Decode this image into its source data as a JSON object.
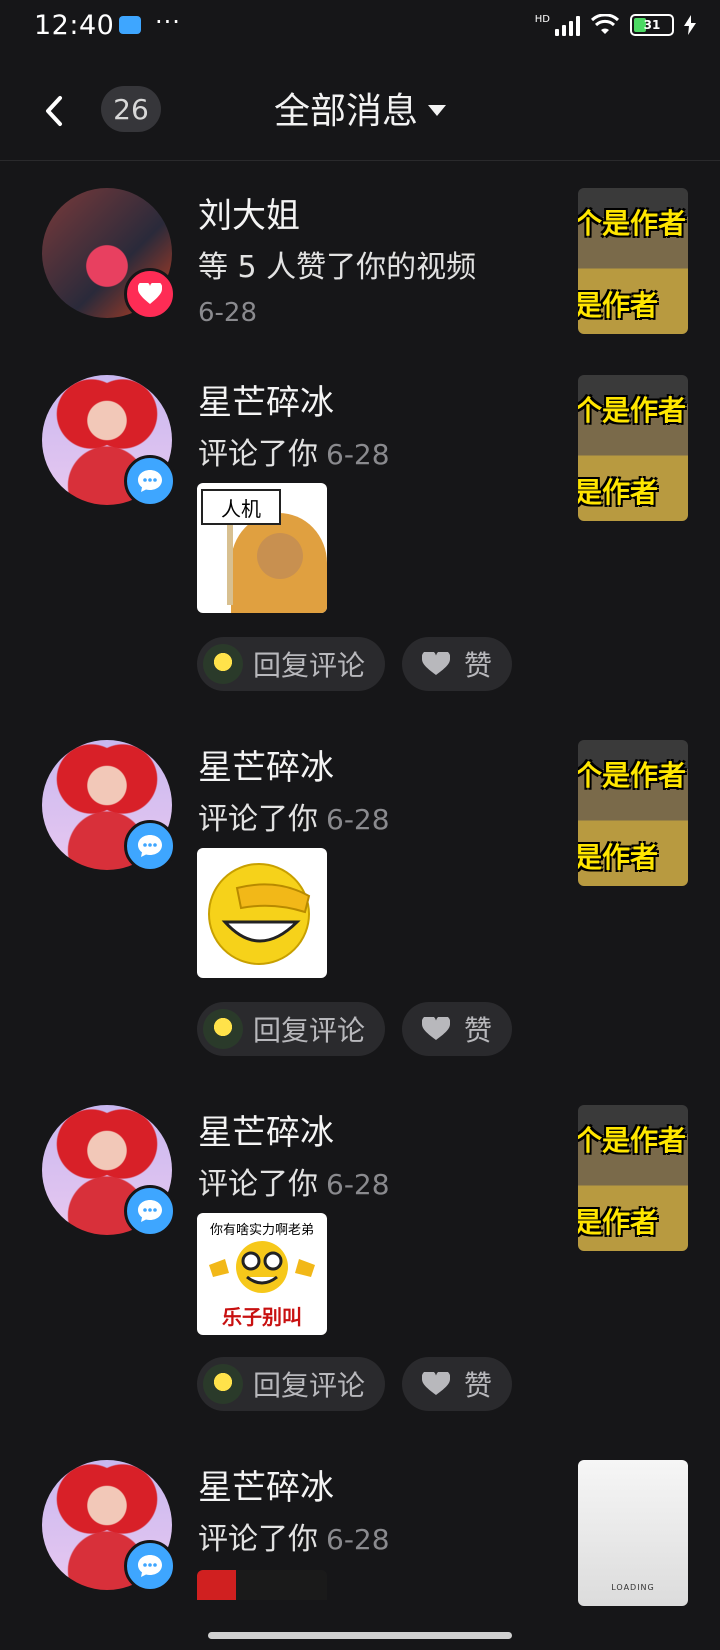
{
  "status_bar": {
    "time": "12:40",
    "network": "HD",
    "battery": "31"
  },
  "header": {
    "unread_count": "26",
    "title": "全部消息"
  },
  "notifications": [
    {
      "name": "刘大姐",
      "action": "等 5 人赞了你的视频",
      "date": "6-28",
      "badge": "heart-icon",
      "thumb_text_top": "个是作者",
      "thumb_text_bottom": "是作者"
    },
    {
      "name": "星芒碎冰",
      "action": "评论了你",
      "date": "6-28",
      "badge": "comment-icon",
      "sticker_text": "人机",
      "reply_label": "回复评论",
      "like_label": "赞",
      "thumb_text_top": "个是作者",
      "thumb_text_bottom": "是作者"
    },
    {
      "name": "星芒碎冰",
      "action": "评论了你",
      "date": "6-28",
      "badge": "comment-icon",
      "reply_label": "回复评论",
      "like_label": "赞",
      "thumb_text_top": "个是作者",
      "thumb_text_bottom": "是作者"
    },
    {
      "name": "星芒碎冰",
      "action": "评论了你",
      "date": "6-28",
      "badge": "comment-icon",
      "sticker_text_top": "你有啥实力啊老弟",
      "sticker_text_bottom": "乐子别叫",
      "reply_label": "回复评论",
      "like_label": "赞",
      "thumb_text_top": "个是作者",
      "thumb_text_bottom": "是作者"
    },
    {
      "name": "星芒碎冰",
      "action": "评论了你",
      "date": "6-28",
      "badge": "comment-icon",
      "thumb_loading": "LOADING"
    }
  ],
  "colors": {
    "background": "#161618",
    "like_badge": "#fe2c55",
    "comment_badge": "#3ea6ff",
    "thumb_caption": "#ffe600"
  }
}
